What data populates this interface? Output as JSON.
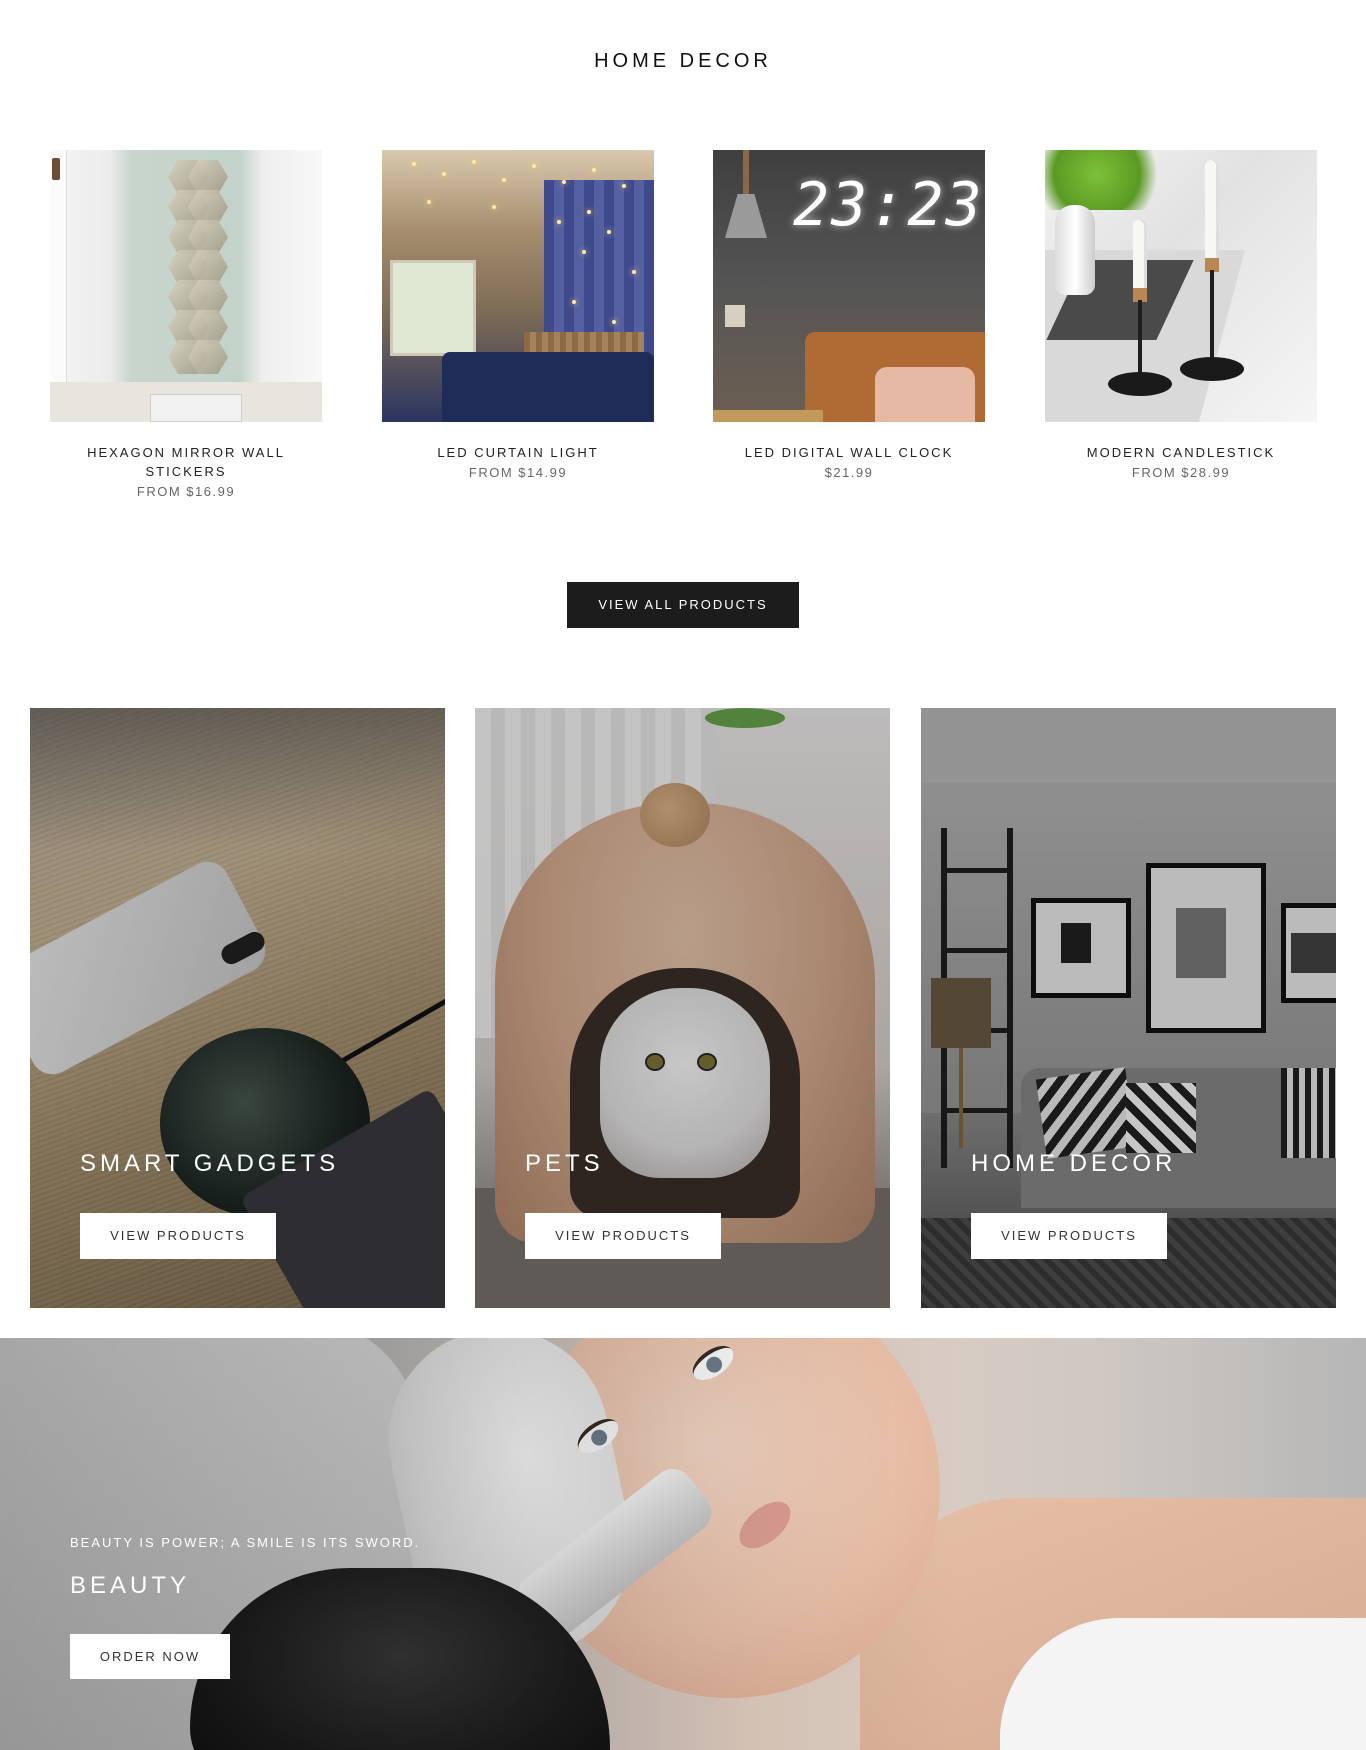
{
  "section": {
    "title": "HOME DECOR"
  },
  "products": [
    {
      "name": "HEXAGON MIRROR WALL STICKERS",
      "price": "FROM $16.99"
    },
    {
      "name": "LED CURTAIN LIGHT",
      "price": "FROM $14.99"
    },
    {
      "name": "LED DIGITAL WALL CLOCK",
      "price": "$21.99",
      "clock_display": "23:23"
    },
    {
      "name": "MODERN CANDLESTICK",
      "price": "FROM $28.99"
    }
  ],
  "view_all_label": "VIEW ALL PRODUCTS",
  "categories": [
    {
      "title": "SMART GADGETS",
      "button_label": "VIEW PRODUCTS"
    },
    {
      "title": "PETS",
      "button_label": "VIEW PRODUCTS"
    },
    {
      "title": "HOME DECOR",
      "button_label": "VIEW PRODUCTS"
    }
  ],
  "banner": {
    "tagline": "BEAUTY IS POWER; A SMILE IS ITS SWORD.",
    "title": "BEAUTY",
    "button_label": "ORDER NOW"
  },
  "colors": {
    "button_dark": "#1c1c1c",
    "text": "#222222",
    "price": "#666666",
    "white": "#ffffff"
  }
}
